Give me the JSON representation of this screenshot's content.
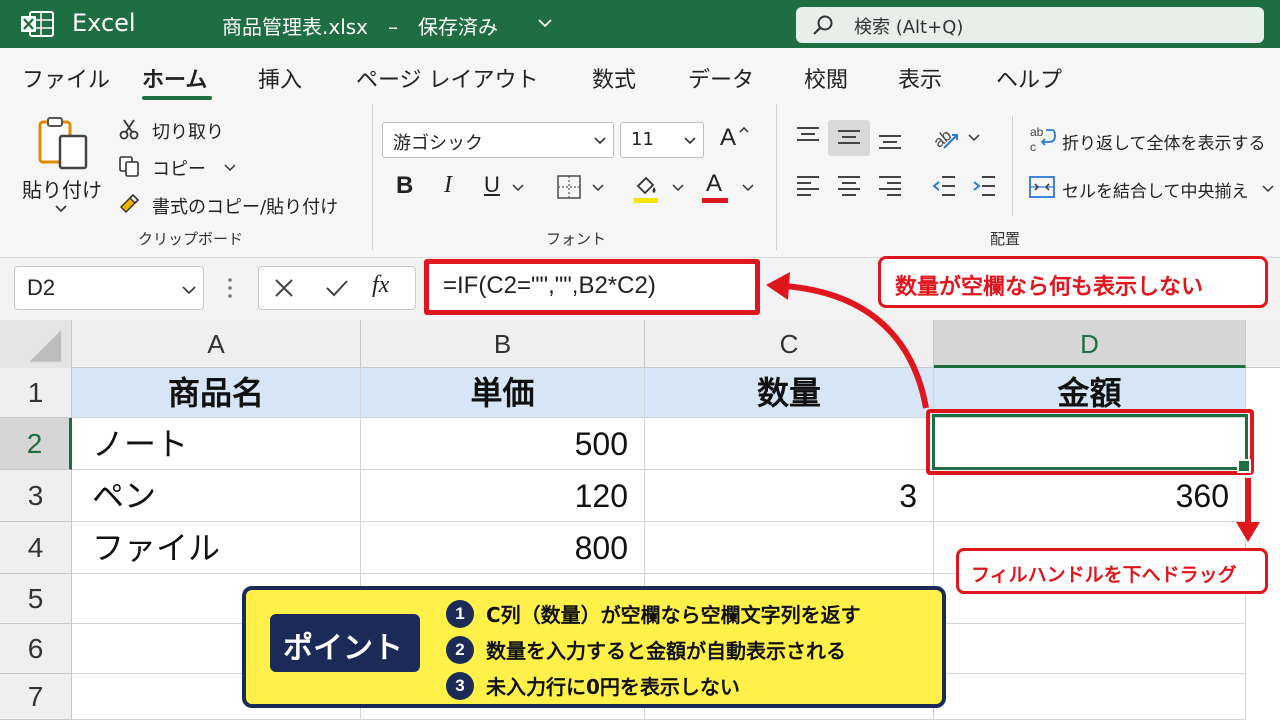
{
  "titlebar": {
    "app_name": "Excel",
    "doc_title": "商品管理表.xlsx　–　保存済み",
    "search_placeholder": "検索 (Alt+Q)"
  },
  "tabs": [
    "ファイル",
    "ホーム",
    "挿入",
    "ページ レイアウト",
    "数式",
    "データ",
    "校閲",
    "表示",
    "ヘルプ"
  ],
  "active_tab": "ホーム",
  "clipboard": {
    "paste_label": "貼り付け",
    "cut_label": "切り取り",
    "copy_label": "コピー",
    "format_painter_label": "書式のコピー/貼り付け",
    "group_label": "クリップボード"
  },
  "font": {
    "font_name": "游ゴシック",
    "font_size": "11",
    "bold": "B",
    "italic": "I",
    "underline": "U",
    "font_color_glyph": "A",
    "grow_glyph": "A",
    "group_label": "フォント",
    "highlight_color": "#f2e500",
    "font_color": "#e0161e"
  },
  "alignment": {
    "wrap_text_label": "折り返して全体を表示する",
    "merge_center_label": "セルを結合して中央揃え",
    "group_label": "配置"
  },
  "formula_bar": {
    "name_box": "D2",
    "fx": "fx",
    "formula": "=IF(C2=\"\",\"\",B2*C2)"
  },
  "grid": {
    "columns": [
      "A",
      "B",
      "C",
      "D"
    ],
    "selected_column": "D",
    "rows": [
      "1",
      "2",
      "3",
      "4",
      "5",
      "6",
      "7"
    ],
    "selected_row": "2",
    "header": [
      "商品名",
      "単価",
      "数量",
      "金額"
    ],
    "data": [
      [
        "ノート",
        "500",
        "",
        ""
      ],
      [
        "ペン",
        "120",
        "3",
        "360"
      ],
      [
        "ファイル",
        "800",
        "",
        ""
      ]
    ],
    "active_cell": "D2"
  },
  "callouts": {
    "formula_note": "数量が空欄なら何も表示しない",
    "drag_note": "フィルハンドルを下へドラッグ"
  },
  "point": {
    "badge": "ポイント",
    "items": [
      {
        "num": "1",
        "text": "C列（数量）が空欄なら空欄文字列を返す"
      },
      {
        "num": "2",
        "text": "数量を入力すると金額が自動表示される"
      },
      {
        "num": "3",
        "text": "未入力行に0円を表示しない"
      }
    ]
  },
  "colors": {
    "excel_green": "#1e6e42",
    "callout_red": "#e0161e",
    "header_fill": "#d6e6f7",
    "point_yellow": "#fff04a",
    "point_navy": "#1b2a57"
  }
}
